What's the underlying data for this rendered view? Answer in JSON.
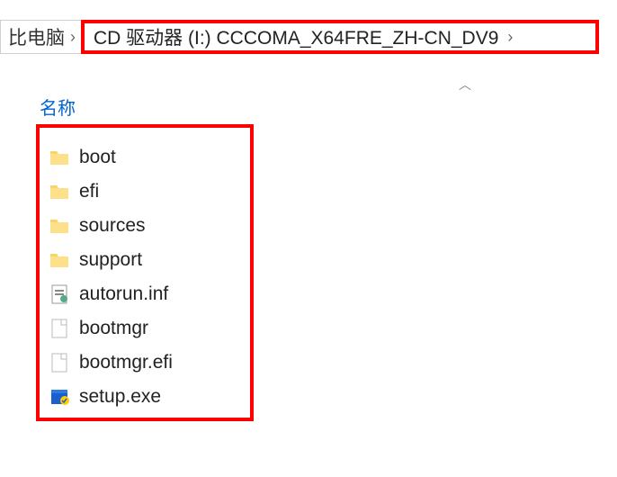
{
  "breadcrumb": {
    "first": "比电脑",
    "sep": "›",
    "current": "CD 驱动器 (I:) CCCOMA_X64FRE_ZH-CN_DV9"
  },
  "column_header": "名称",
  "sort_indicator": "︿",
  "items": [
    {
      "name": "boot",
      "icon": "folder"
    },
    {
      "name": "efi",
      "icon": "folder"
    },
    {
      "name": "sources",
      "icon": "folder"
    },
    {
      "name": "support",
      "icon": "folder"
    },
    {
      "name": "autorun.inf",
      "icon": "inf"
    },
    {
      "name": "bootmgr",
      "icon": "file"
    },
    {
      "name": "bootmgr.efi",
      "icon": "file"
    },
    {
      "name": "setup.exe",
      "icon": "exe"
    }
  ]
}
